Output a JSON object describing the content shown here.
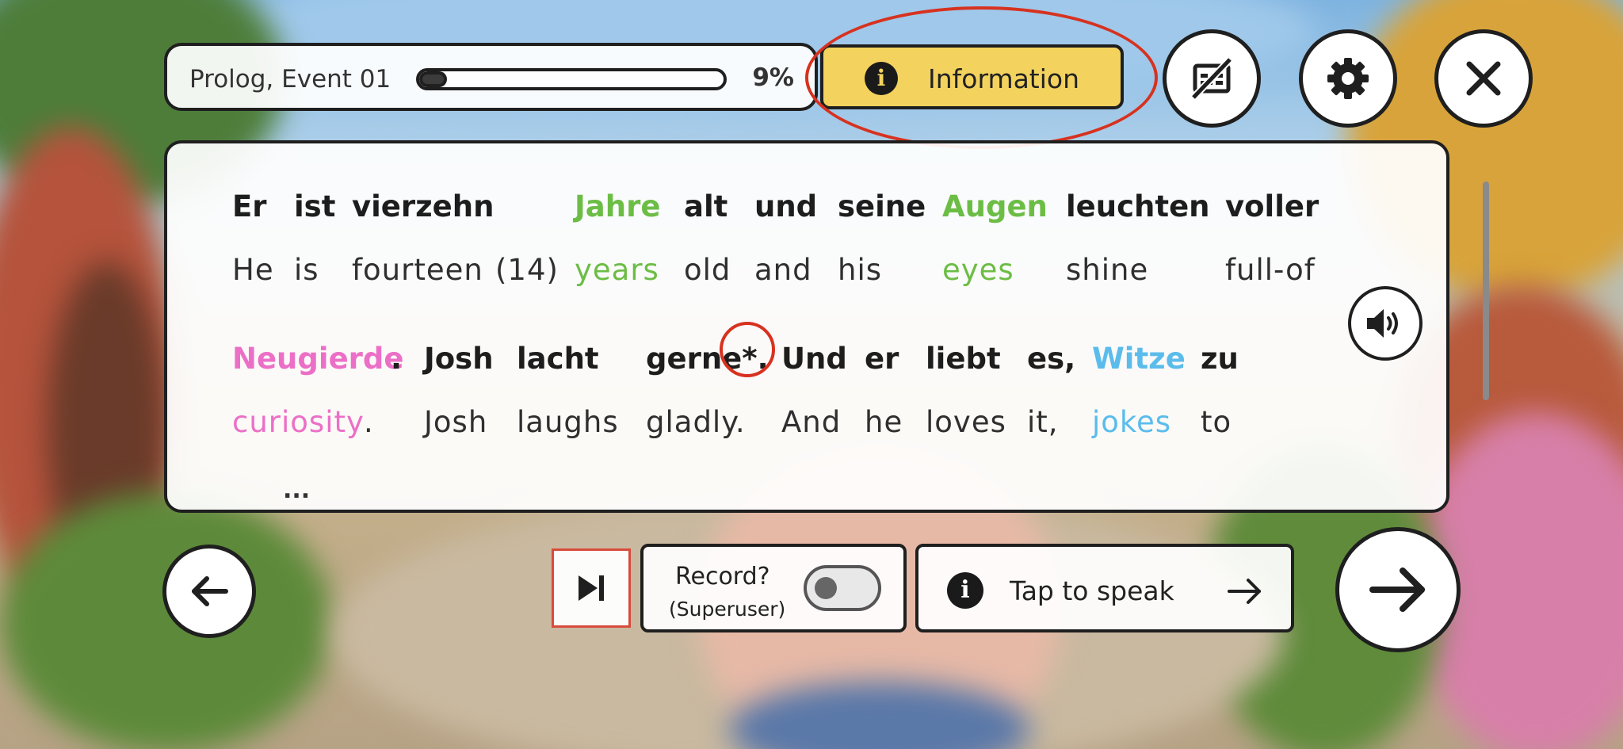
{
  "progress": {
    "label": "Prolog, Event 01",
    "percent_text": "9%",
    "value": 0.09
  },
  "info_button": {
    "label": "Information",
    "icon": "info-icon"
  },
  "top_icons": [
    "subtitles-off-icon",
    "gear-icon",
    "close-icon"
  ],
  "text": {
    "line1_de": [
      "Er",
      "ist",
      "vierzehn",
      "Jahre",
      "alt",
      "und",
      "seine",
      "Augen",
      "leuchten",
      "voller"
    ],
    "line1_en": [
      "He",
      "is",
      "fourteen",
      "(14)",
      "years",
      "old",
      "and",
      "his",
      "eyes",
      "shine",
      "full-of"
    ],
    "line2_de": [
      "Neugierde",
      ".",
      "Josh",
      "lacht",
      "gerne*.",
      "Und",
      "er",
      "liebt",
      "es,",
      "Witze",
      "zu"
    ],
    "line2_en": [
      "curiosity",
      ".",
      "Josh",
      "laughs",
      "gladly.",
      "And",
      "he",
      "loves",
      "it,",
      "jokes",
      "to"
    ],
    "more": "...",
    "highlight_colors": {
      "green": "#6cbd45",
      "pink": "#ec6fc7",
      "blue": "#5bbcec"
    }
  },
  "record": {
    "label": "Record?",
    "sub": "(Superuser)",
    "enabled": false
  },
  "speak": {
    "label": "Tap to speak",
    "icon": "info-icon"
  },
  "accent": {
    "yellow": "#f3d35e",
    "annotation_red": "#d7321f"
  }
}
